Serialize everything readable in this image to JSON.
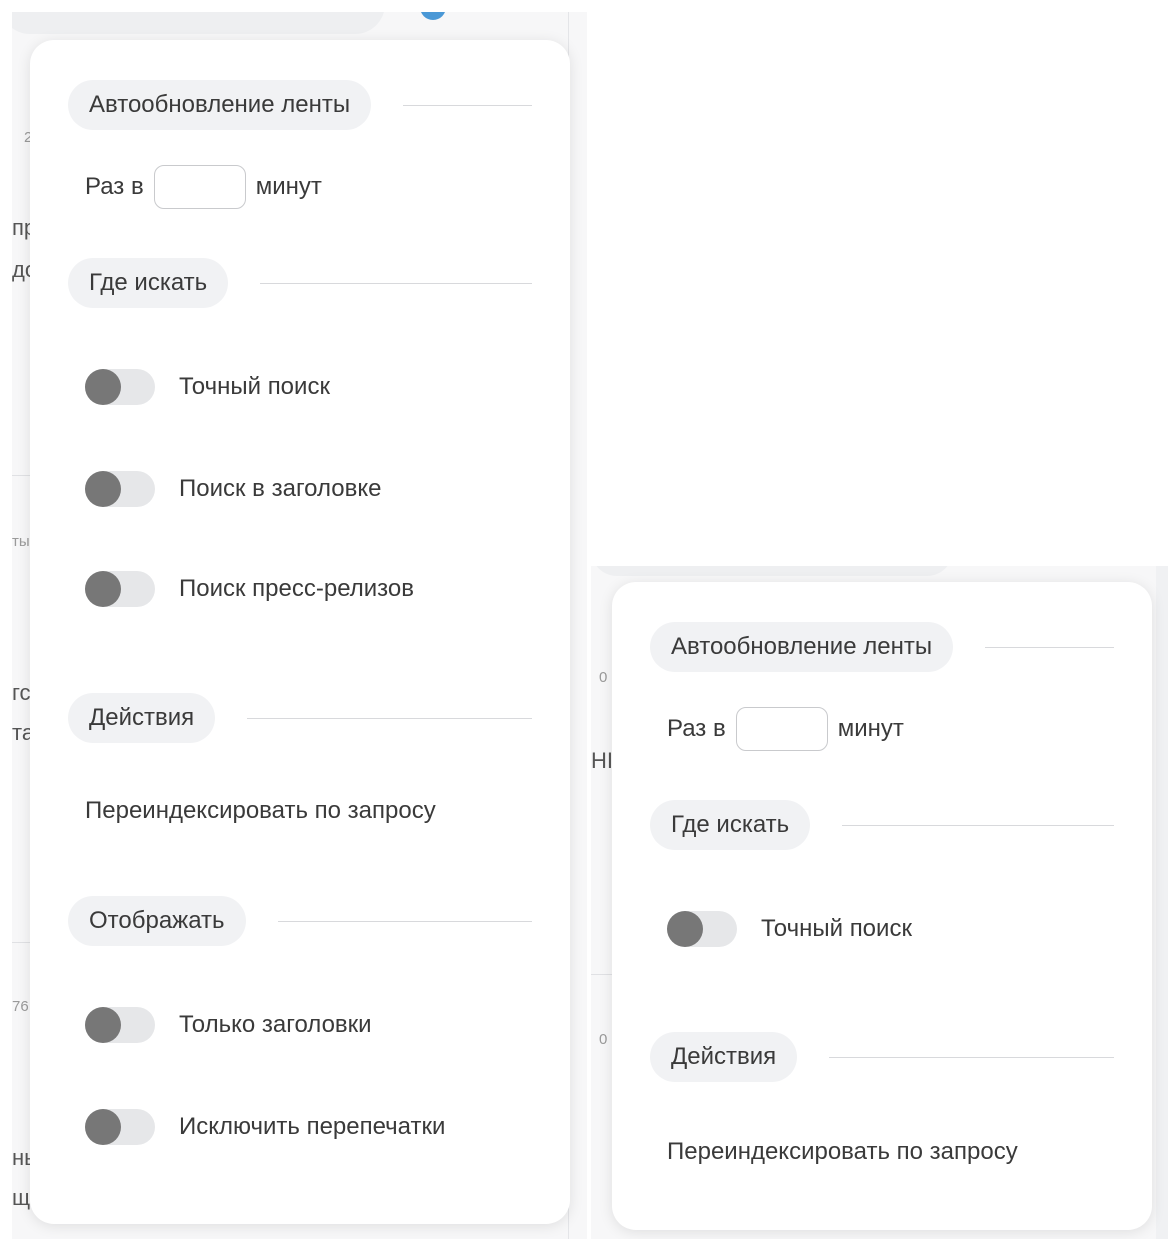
{
  "left_panel": {
    "background_fragments": [
      "2",
      "пр",
      "до",
      "ты",
      "гс",
      "та",
      "76",
      "нь",
      "щ"
    ],
    "sections": {
      "auto_refresh": {
        "title": "Автообновление ленты",
        "prefix": "Раз в",
        "input_value": "",
        "suffix": "минут"
      },
      "where": {
        "title": "Где искать",
        "options": [
          {
            "label": "Точный поиск",
            "on": false
          },
          {
            "label": "Поиск в заголовке",
            "on": false
          },
          {
            "label": "Поиск пресс-релизов",
            "on": false
          }
        ]
      },
      "actions": {
        "title": "Действия",
        "reindex": "Переиндексировать по запросу"
      },
      "display": {
        "title": "Отображать",
        "options": [
          {
            "label": "Только заголовки",
            "on": false
          },
          {
            "label": "Исключить перепечатки",
            "on": false
          }
        ]
      }
    }
  },
  "right_panel": {
    "background_fragments": [
      "0",
      "HI",
      "0"
    ],
    "sections": {
      "auto_refresh": {
        "title": "Автообновление ленты",
        "prefix": "Раз в",
        "input_value": "",
        "suffix": "минут"
      },
      "where": {
        "title": "Где искать",
        "options": [
          {
            "label": "Точный поиск",
            "on": false
          }
        ]
      },
      "actions": {
        "title": "Действия",
        "reindex": "Переиндексировать по запросу"
      }
    }
  },
  "colors": {
    "card_bg": "#ffffff",
    "pill_bg": "#f1f2f4",
    "toggle_track": "#e6e7e9",
    "toggle_knob": "#777777",
    "text": "#3a3a3a",
    "accent_dot": "#4a98d6"
  }
}
